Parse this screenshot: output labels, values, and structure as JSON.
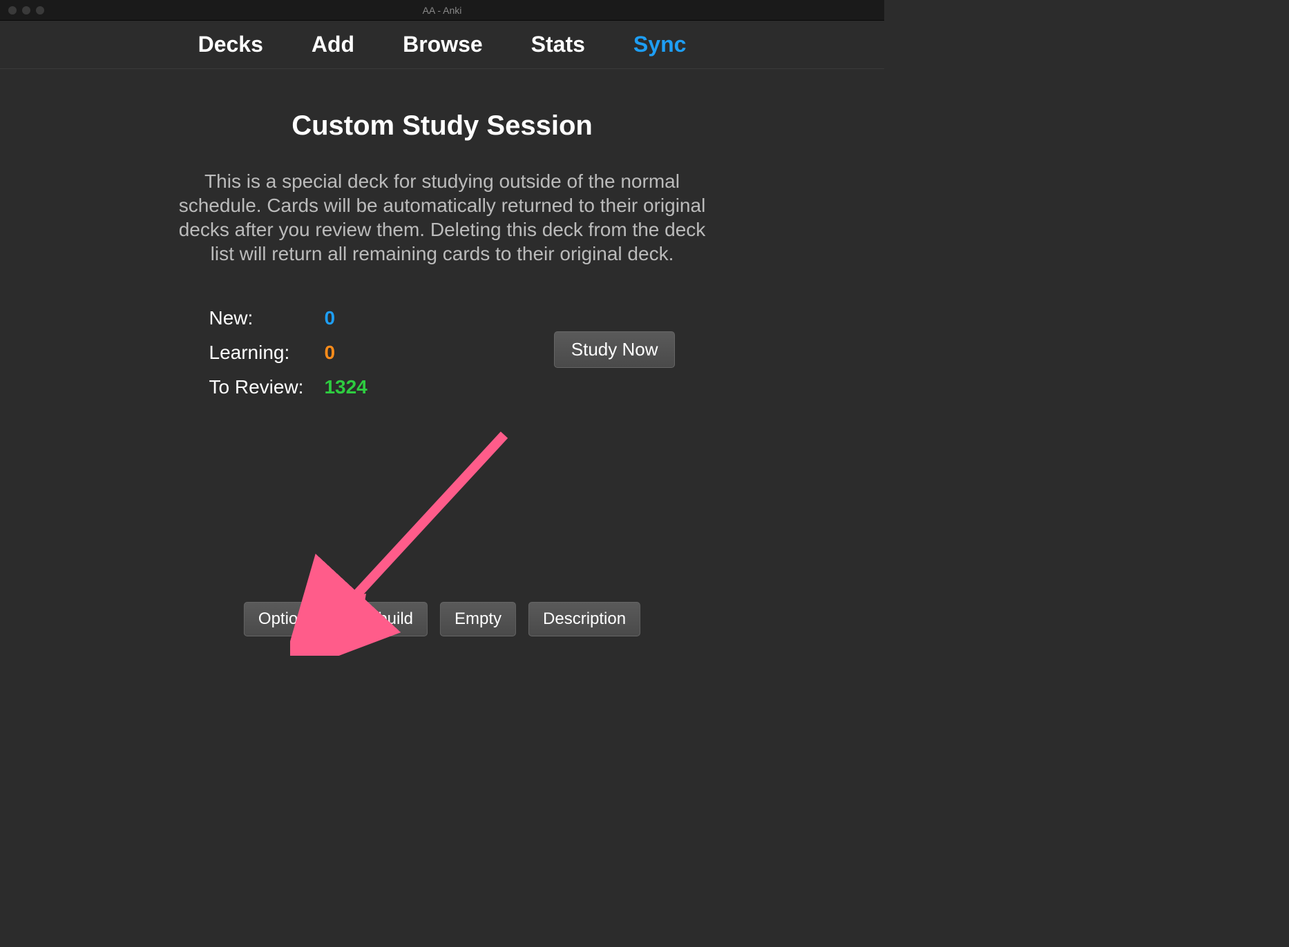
{
  "window": {
    "title": "AA - Anki"
  },
  "nav": {
    "items": [
      {
        "label": "Decks",
        "active": false
      },
      {
        "label": "Add",
        "active": false
      },
      {
        "label": "Browse",
        "active": false
      },
      {
        "label": "Stats",
        "active": false
      },
      {
        "label": "Sync",
        "active": true
      }
    ]
  },
  "deck": {
    "title": "Custom Study Session",
    "description": "This is a special deck for studying outside of the normal schedule. Cards will be automatically returned to their original decks after you review them. Deleting this deck from the deck list will return all remaining cards to their original deck."
  },
  "stats": {
    "new_label": "New:",
    "new_value": "0",
    "learning_label": "Learning:",
    "learning_value": "0",
    "review_label": "To Review:",
    "review_value": "1324"
  },
  "buttons": {
    "study_now": "Study Now",
    "options": "Options",
    "rebuild": "Rebuild",
    "empty": "Empty",
    "description": "Description"
  },
  "annotation": {
    "arrow_color": "#ff5c8a"
  }
}
